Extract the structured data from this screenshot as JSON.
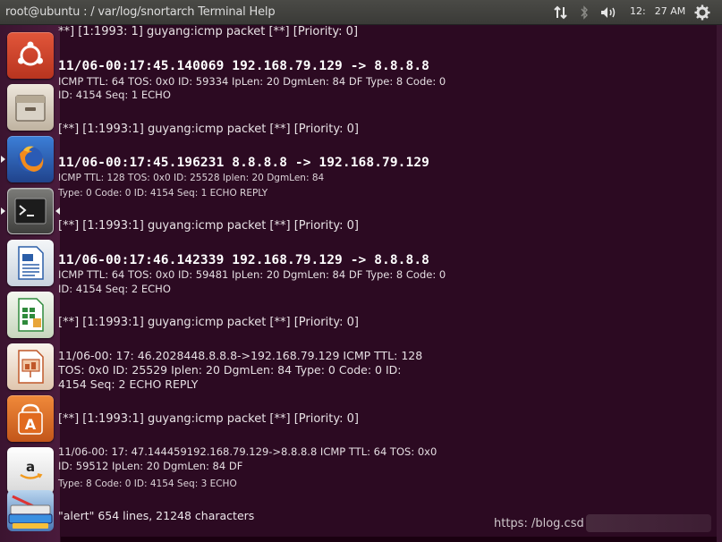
{
  "panel": {
    "title": "root@ubuntu : / var/log/snortarch Terminal Help",
    "clock_hour": "12:",
    "clock_min": "27 AM"
  },
  "launcher": {
    "items": [
      "ubuntu-dash",
      "files",
      "firefox",
      "terminal",
      "libreoffice-writer",
      "libreoffice-calc",
      "libreoffice-impress",
      "software-center",
      "amazon",
      "stacked-windows"
    ]
  },
  "terminal": {
    "lines": [
      "**] [1:1993: 1] guyang:icmp packet [**] [Priority: 0]",
      "11/06-00:17:45.140069 192.168.79.129 -> 8.8.8.8",
      "ICMP TTL: 64 TOS: 0x0 ID: 59334 IpLen: 20 DgmLen: 84 DF Type: 8 Code: 0",
      "ID: 4154 Seq: 1 ECHO",
      "[**] [1:1993:1] guyang:icmp packet [**] [Priority: 0]",
      "11/06-00:17:45.196231 8.8.8.8 -> 192.168.79.129",
      "ICMP TTL: 128 TOS: 0x0 ID: 25528 Iplen: 20 DgmLen: 84",
      "Type: 0 Code: 0 ID: 4154 Seq: 1 ECHO REPLY",
      "[**] [1:1993:1] guyang:icmp packet [**] [Priority: 0]",
      "11/06-00:17:46.142339 192.168.79.129 -> 8.8.8.8",
      "ICMP TTL: 64 TOS: 0x0 ID: 59481 IpLen: 20 DgmLen: 84 DF Type: 8 Code: 0",
      "ID: 4154 Seq: 2 ECHO",
      "[**] [1:1993:1] guyang:icmp packet [**] [Priority: 0]",
      "11/06-00: 17: 46.2028448.8.8.8->192.168.79.129 ICMP TTL: 128",
      "TOS: 0x0 ID: 25529 Iplen: 20 DgmLen: 84 Type: 0 Code: 0 ID:",
      "4154 Seq: 2 ECHO REPLY",
      "[**] [1:1993:1] guyang:icmp packet [**] [Priority: 0]",
      "11/06-00: 17: 47.144459192.168.79.129->8.8.8.8 ICMP TTL: 64 TOS: 0x0",
      "ID: 59512 IpLen: 20 DgmLen: 84 DF",
      "Type: 8 Code: 0 ID: 4154 Seq: 3 ECHO"
    ],
    "status": "\"alert\" 654 lines, 21248 characters",
    "watermark": "https: /blog.csd"
  }
}
